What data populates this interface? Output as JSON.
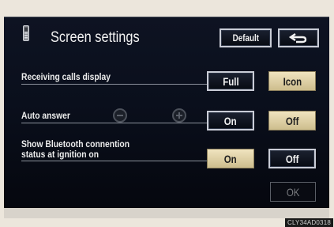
{
  "title": "Screen settings",
  "header": {
    "default_label": "Default",
    "back_icon": "back-arrow-icon",
    "phone_icon": "phone-icon"
  },
  "rows": {
    "receiving_calls": {
      "label": "Receiving calls display",
      "options": [
        "Full",
        "Icon"
      ],
      "selected": "Icon"
    },
    "auto_answer": {
      "label": "Auto answer",
      "minus_icon": "minus-icon",
      "plus_icon": "plus-icon",
      "options": [
        "On",
        "Off"
      ],
      "selected": "Off"
    },
    "bluetooth_status": {
      "label_line1": "Show Bluetooth connention",
      "label_line2": "status at ignition on",
      "options": [
        "On",
        "Off"
      ],
      "selected": "On"
    }
  },
  "footer": {
    "ok_label": "OK"
  },
  "caption": "CLY34AD0318",
  "colors": {
    "screen_bg": "#0a0f1c",
    "selected_button": "#e6d8ac",
    "button_border": "#c9ccd6",
    "frame": "#ece6dc"
  }
}
